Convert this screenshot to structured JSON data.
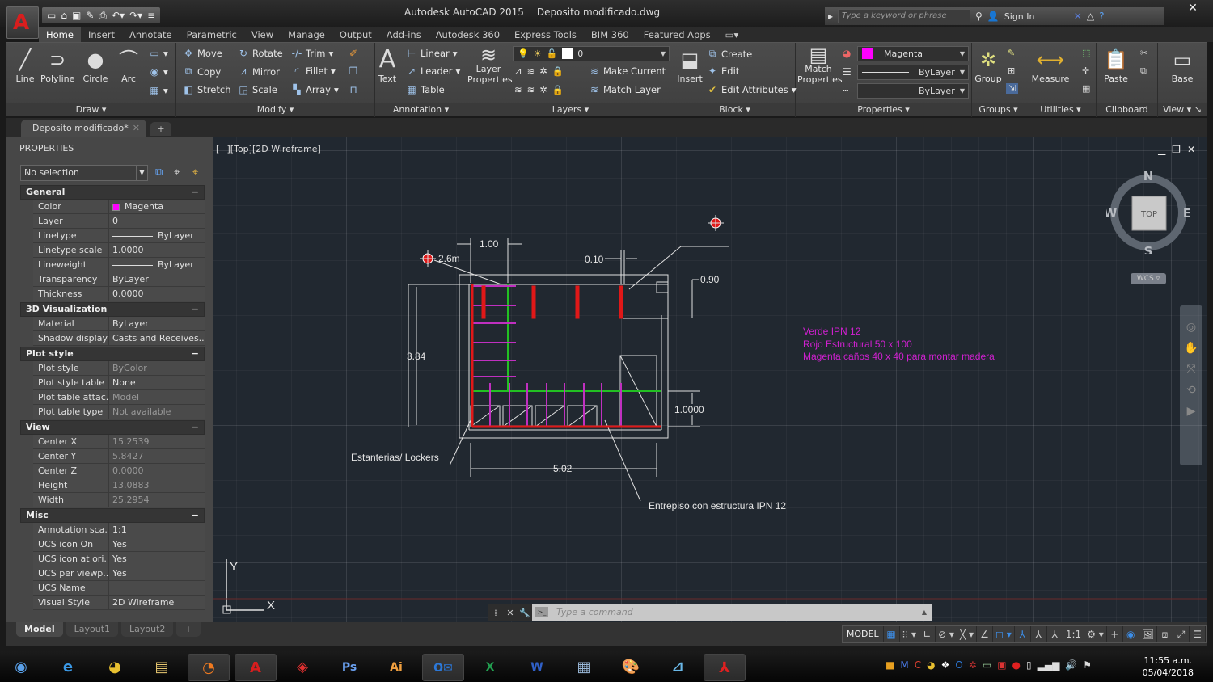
{
  "window": {
    "app_title": "Autodesk AutoCAD 2015",
    "file_title": "Deposito modificado.dwg",
    "search_placeholder": "Type a keyword or phrase",
    "sign_in": "Sign In"
  },
  "ribbon_tabs": [
    "Home",
    "Insert",
    "Annotate",
    "Parametric",
    "View",
    "Manage",
    "Output",
    "Add-ins",
    "Autodesk 360",
    "Express Tools",
    "BIM 360",
    "Featured Apps"
  ],
  "ribbon": {
    "draw": {
      "title": "Draw",
      "line": "Line",
      "polyline": "Polyline",
      "circle": "Circle",
      "arc": "Arc"
    },
    "modify": {
      "title": "Modify",
      "move": "Move",
      "rotate": "Rotate",
      "trim": "Trim",
      "copy": "Copy",
      "mirror": "Mirror",
      "fillet": "Fillet",
      "stretch": "Stretch",
      "scale": "Scale",
      "array": "Array"
    },
    "annotation": {
      "title": "Annotation",
      "text": "Text",
      "linear": "Linear",
      "leader": "Leader",
      "table": "Table"
    },
    "layers": {
      "title": "Layers",
      "layer_properties_1": "Layer",
      "layer_properties_2": "Properties",
      "current_layer": "0",
      "make_current": "Make Current",
      "match_layer": "Match Layer"
    },
    "block": {
      "title": "Block",
      "insert": "Insert",
      "create": "Create",
      "edit": "Edit",
      "edit_attributes": "Edit Attributes"
    },
    "properties": {
      "title": "Properties",
      "match_1": "Match",
      "match_2": "Properties",
      "color": "Magenta",
      "color_hex": "#ff00ff",
      "lineweight": "ByLayer",
      "linetype": "ByLayer"
    },
    "groups": {
      "title": "Groups",
      "group": "Group"
    },
    "utilities": {
      "title": "Utilities",
      "measure": "Measure"
    },
    "clipboard": {
      "title": "Clipboard",
      "paste": "Paste"
    },
    "view": {
      "title": "View",
      "base": "Base"
    }
  },
  "file_tab": "Deposito modificado*",
  "properties_palette": {
    "title": "PROPERTIES",
    "selection": "No selection",
    "general": {
      "title": "General",
      "rows": [
        {
          "k": "Color",
          "v": "Magenta"
        },
        {
          "k": "Layer",
          "v": "0"
        },
        {
          "k": "Linetype",
          "v": "ByLayer"
        },
        {
          "k": "Linetype scale",
          "v": "1.0000"
        },
        {
          "k": "Lineweight",
          "v": "ByLayer"
        },
        {
          "k": "Transparency",
          "v": "ByLayer"
        },
        {
          "k": "Thickness",
          "v": "0.0000"
        }
      ]
    },
    "viz3d": {
      "title": "3D Visualization",
      "rows": [
        {
          "k": "Material",
          "v": "ByLayer"
        },
        {
          "k": "Shadow display",
          "v": "Casts  and  Receives..."
        }
      ]
    },
    "plot": {
      "title": "Plot style",
      "rows": [
        {
          "k": "Plot style",
          "v": "ByColor"
        },
        {
          "k": "Plot style table",
          "v": "None"
        },
        {
          "k": "Plot table attac...",
          "v": "Model"
        },
        {
          "k": "Plot table type",
          "v": "Not available"
        }
      ]
    },
    "view": {
      "title": "View",
      "rows": [
        {
          "k": "Center X",
          "v": "15.2539"
        },
        {
          "k": "Center Y",
          "v": "5.8427"
        },
        {
          "k": "Center Z",
          "v": "0.0000"
        },
        {
          "k": "Height",
          "v": "13.0883"
        },
        {
          "k": "Width",
          "v": "25.2954"
        }
      ]
    },
    "misc": {
      "title": "Misc",
      "rows": [
        {
          "k": "Annotation  sca...",
          "v": "1:1"
        },
        {
          "k": "UCS icon On",
          "v": "Yes"
        },
        {
          "k": "UCS icon  at ori...",
          "v": "Yes"
        },
        {
          "k": "UCS  per viewp...",
          "v": "Yes"
        },
        {
          "k": "UCS Name",
          "v": ""
        },
        {
          "k": "Visual Style",
          "v": "2D Wireframe"
        }
      ]
    }
  },
  "layout_tabs": [
    "Model",
    "Layout1",
    "Layout2"
  ],
  "viewport": {
    "label": "[−][Top][2D Wireframe]",
    "viewcube": {
      "n": "N",
      "s": "S",
      "e": "E",
      "w": "W",
      "face": "TOP",
      "wcs": "WCS"
    },
    "dimensions": {
      "d100": "1.00",
      "d010": "0.10",
      "d090": "0.90",
      "d384": "3.84",
      "d10000": "1.0000",
      "d502": "5.02",
      "level": "2.6m"
    },
    "labels": {
      "lockers": "Estanterias/ Lockers",
      "entrepiso": "Entrepiso con estructura IPN 12"
    },
    "legend": [
      "Verde IPN  12",
      "Rojo Estructural 50 x 100",
      "Magenta caños 40 x  40 para montar madera"
    ],
    "ucs_x": "X",
    "ucs_y": "Y"
  },
  "command_line": {
    "placeholder": "Type  a  command"
  },
  "status": {
    "model": "MODEL",
    "scale": "1:1"
  },
  "taskbar": {
    "apps": [
      "Start",
      "Internet Explorer",
      "Chrome",
      "File Explorer",
      "Firefox",
      "AutoCAD",
      "SketchUp",
      "Photoshop",
      "Illustrator",
      "Outlook",
      "Excel",
      "Word",
      "Calculator",
      "Paint",
      "Scanner",
      "Acrobat"
    ],
    "time": "11:55 a.m.",
    "date": "05/04/2018"
  }
}
